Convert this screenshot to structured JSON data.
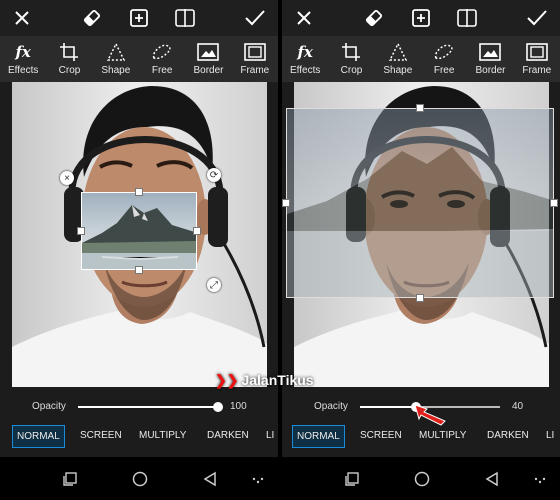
{
  "toolbar": [
    {
      "label": "Effects",
      "icon": "fx-icon"
    },
    {
      "label": "Crop",
      "icon": "crop-icon"
    },
    {
      "label": "Shape",
      "icon": "shape-icon"
    },
    {
      "label": "Free",
      "icon": "free-icon"
    },
    {
      "label": "Border",
      "icon": "border-icon"
    },
    {
      "label": "Frame",
      "icon": "frame-icon"
    }
  ],
  "left": {
    "opacity_label": "Opacity",
    "opacity_value": "100",
    "opacity_fraction": 1.0,
    "modes": [
      "NORMAL",
      "SCREEN",
      "MULTIPLY",
      "DARKEN",
      "LI"
    ],
    "active_mode": "NORMAL"
  },
  "right": {
    "opacity_label": "Opacity",
    "opacity_value": "40",
    "opacity_fraction": 0.4,
    "modes": [
      "NORMAL",
      "SCREEN",
      "MULTIPLY",
      "DARKEN",
      "LI"
    ],
    "active_mode": "NORMAL"
  },
  "watermark": {
    "prefix": "Jalan",
    "suffix": "Tikus"
  },
  "colors": {
    "accent": "#1a8bd8",
    "bar": "#2b2b2b",
    "arrow": "#e0201a"
  }
}
